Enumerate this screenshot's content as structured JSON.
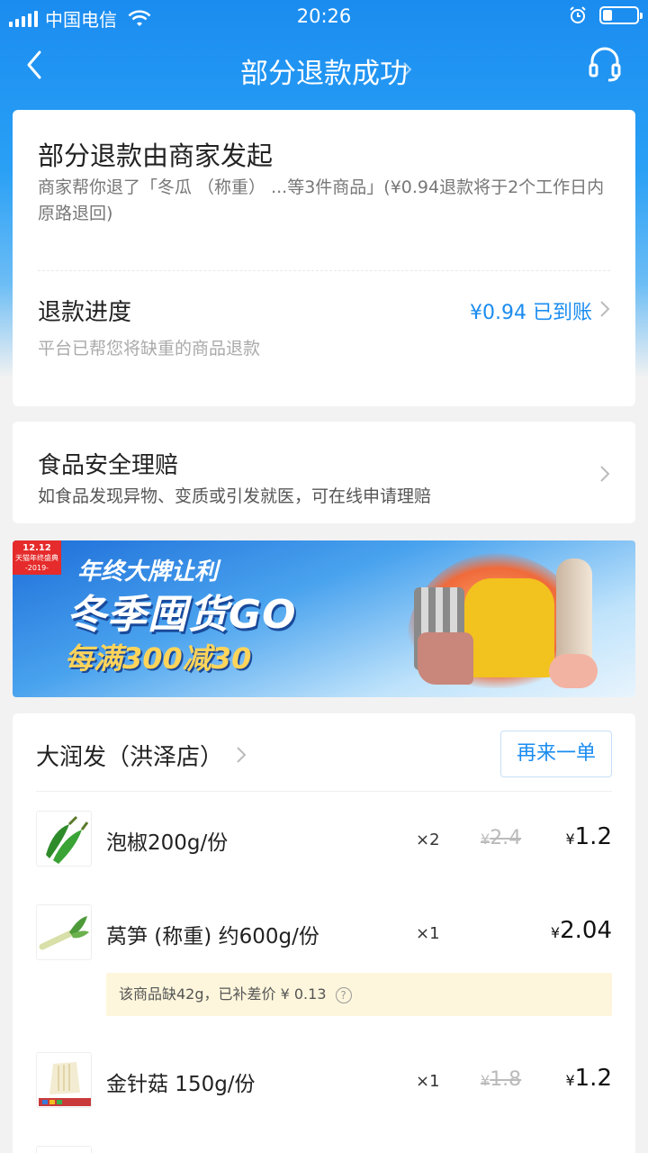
{
  "status_bar": {
    "carrier": "中国电信",
    "time": "20:26"
  },
  "nav": {
    "title": "部分退款成功"
  },
  "refund_card": {
    "heading": "部分退款由商家发起",
    "description": "商家帮你退了「冬瓜 （称重） ...等3件商品」(¥0.94退款将于2个工作日内原路退回)",
    "progress_label": "退款进度",
    "progress_status": "¥0.94 已到账",
    "progress_sub": "平台已帮您将缺重的商品退款"
  },
  "food_safety": {
    "title": "食品安全理赔",
    "subtitle": "如食品发现异物、变质或引发就医，可在线申请理赔"
  },
  "banner": {
    "badge_top": "12.12",
    "badge_mid": "天猫年终盛典",
    "badge_bottom": "-2019-",
    "line1": "年终大牌让利",
    "line2": "冬季囤货GO",
    "line3": "每满300减30"
  },
  "order": {
    "shop_name": "大润发（洪泽店）",
    "reorder_label": "再来一单",
    "items": [
      {
        "name": "泡椒200g/份",
        "qty": "×2",
        "original_price": "2.4",
        "price": "1.2",
        "currency": "¥"
      },
      {
        "name": "莴笋 (称重) 约600g/份",
        "qty": "×1",
        "original_price": "",
        "price": "2.04",
        "currency": "¥"
      },
      {
        "name": "金针菇 150g/份",
        "qty": "×1",
        "original_price": "1.8",
        "price": "1.2",
        "currency": "¥"
      }
    ],
    "shortage_notice": "该商品缺42g，已补差价 ¥ 0.13",
    "help_glyph": "?"
  },
  "colors": {
    "primary": "#1a8cf0",
    "header_gradient_top": "#1a8cf0",
    "notice_bg": "#fdf6dc"
  },
  "icons": {
    "back": "chevron-left-icon",
    "service": "headset-icon",
    "chevron": "chevron-right-icon",
    "wifi": "wifi-icon",
    "alarm": "alarm-icon",
    "battery": "battery-icon",
    "help": "question-circle-icon"
  }
}
